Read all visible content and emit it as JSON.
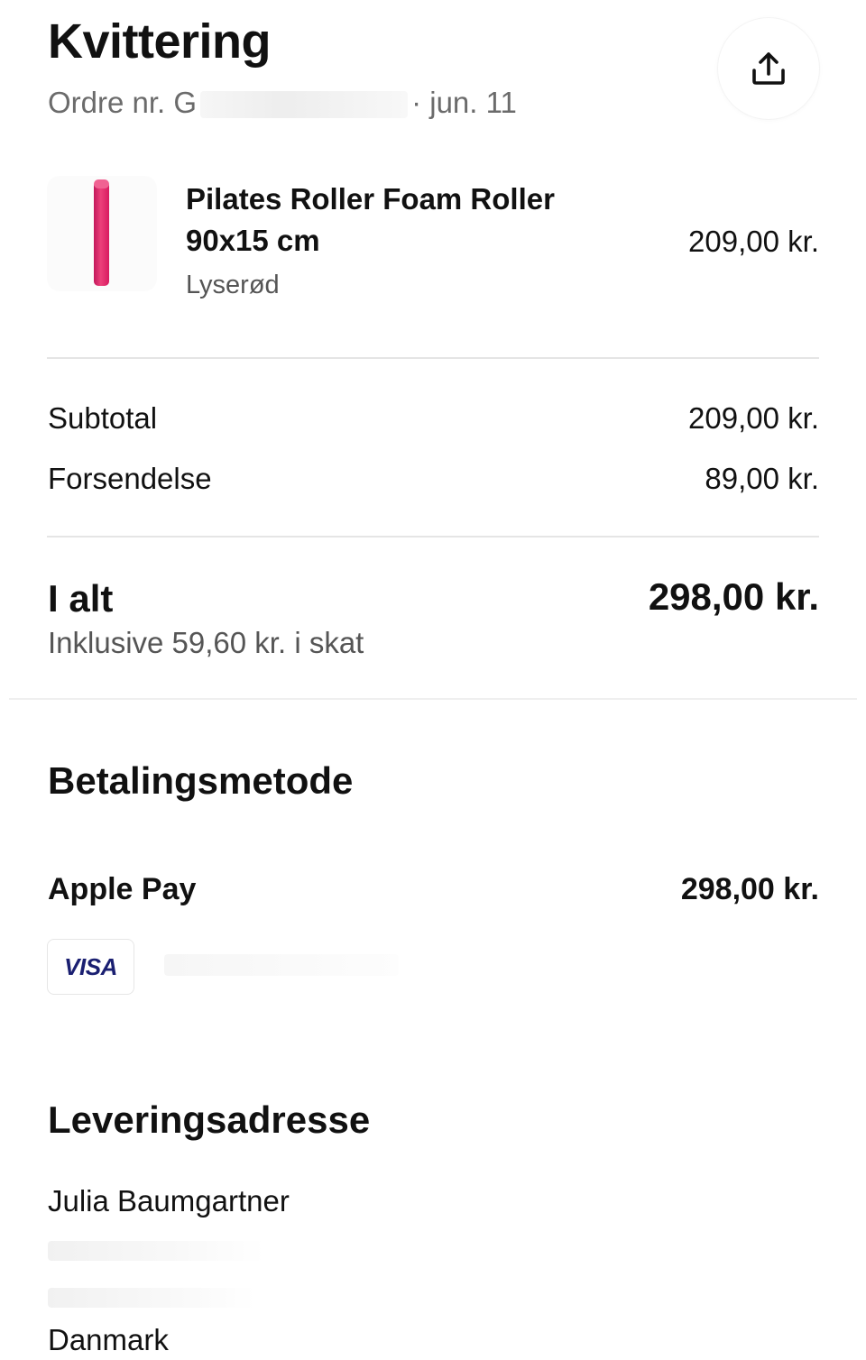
{
  "header": {
    "title": "Kvittering",
    "order_prefix": "Ordre nr. G",
    "order_date": "jun. 11",
    "separator": "·"
  },
  "icons": {
    "share": "share-upload-icon"
  },
  "product": {
    "name": "Pilates Roller Foam Roller 90x15 cm",
    "variant": "Lyserød",
    "price": "209,00 kr.",
    "thumb_color": "#e0307a"
  },
  "summary": {
    "subtotal_label": "Subtotal",
    "subtotal_value": "209,00 kr.",
    "shipping_label": "Forsendelse",
    "shipping_value": "89,00 kr."
  },
  "total": {
    "label": "I alt",
    "value": "298,00 kr.",
    "tax_note": "Inklusive 59,60 kr. i skat"
  },
  "payment": {
    "heading": "Betalingsmetode",
    "method": "Apple Pay",
    "amount": "298,00 kr.",
    "card_brand": "VISA",
    "card_brand_color": "#1a1f71"
  },
  "delivery": {
    "heading": "Leveringsadresse",
    "name": "Julia Baumgartner",
    "country": "Danmark"
  }
}
